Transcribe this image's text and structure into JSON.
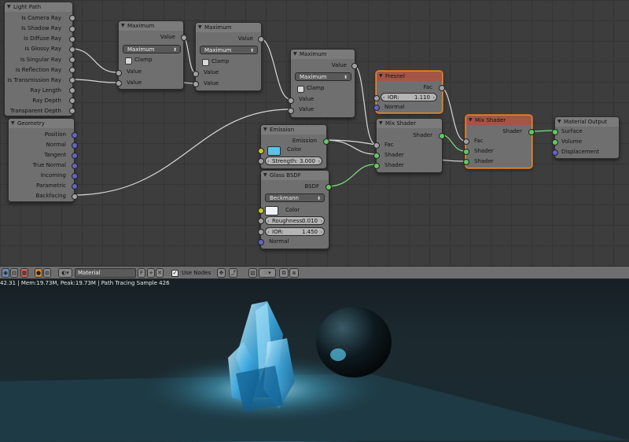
{
  "nodes": {
    "light_path": {
      "title": "Light Path",
      "outputs": [
        "Is Camera Ray",
        "Is Shadow Ray",
        "Is Diffuse Ray",
        "Is Glossy Ray",
        "Is Singular Ray",
        "Is Reflection Ray",
        "Is Transmission Ray",
        "Ray Length",
        "Ray Depth",
        "Transparent Depth"
      ]
    },
    "maximum1": {
      "title": "Maximum",
      "output": "Value",
      "operation": "Maximum",
      "clamp": "Clamp",
      "input1": "Value",
      "input2": "Value"
    },
    "maximum2": {
      "title": "Maximum",
      "output": "Value",
      "operation": "Maximum",
      "clamp": "Clamp",
      "input1": "Value",
      "input2": "Value"
    },
    "maximum3": {
      "title": "Maximum",
      "output": "Value",
      "operation": "Maximum",
      "clamp": "Clamp",
      "input1": "Value",
      "input2": "Value"
    },
    "geometry": {
      "title": "Geometry",
      "outputs": [
        "Position",
        "Normal",
        "Tangent",
        "True Normal",
        "Incoming",
        "Parametric",
        "Backfacing"
      ]
    },
    "fresnel": {
      "title": "Fresnel",
      "output": "Fac",
      "ior_label": "IOR:",
      "ior_value": "1.110",
      "input": "Normal"
    },
    "emission": {
      "title": "Emission",
      "output": "Emission",
      "color_label": "Color",
      "strength_label": "Strength:",
      "strength_value": "3.000",
      "color": "#5cc3e6"
    },
    "glass": {
      "title": "Glass BSDF",
      "output": "BSDF",
      "distribution": "Beckmann",
      "color_label": "Color",
      "roughness_label": "Roughness:",
      "roughness_value": "0.010",
      "ior_label": "IOR:",
      "ior_value": "1.450",
      "normal_label": "Normal",
      "color": "#eef2ff"
    },
    "mix1": {
      "title": "Mix Shader",
      "output": "Shader",
      "fac": "Fac",
      "shader1": "Shader",
      "shader2": "Shader"
    },
    "mix2": {
      "title": "Mix Shader",
      "output": "Shader",
      "fac": "Fac",
      "shader1": "Shader",
      "shader2": "Shader"
    },
    "output": {
      "title": "Material Output",
      "inputs": [
        "Surface",
        "Volume",
        "Displacement"
      ]
    }
  },
  "header": {
    "material_name": "Material",
    "fake_user": "F",
    "use_nodes_label": "Use Nodes"
  },
  "viewport": {
    "status": "42.31 | Mem:19.73M, Peak:19.73M | Path Tracing Sample 426"
  },
  "colors": {
    "socket_value": "#a1a1a1",
    "socket_shader": "#63c763",
    "socket_vector": "#6363c7",
    "socket_color": "#c7c729",
    "selection": "#e58a2d"
  }
}
